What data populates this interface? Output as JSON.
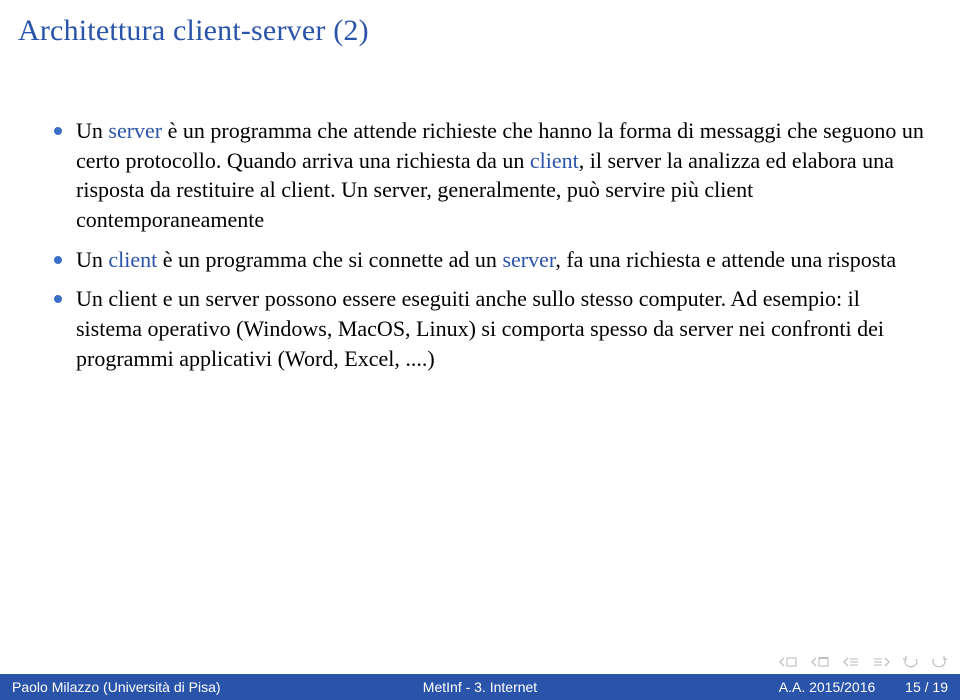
{
  "title": "Architettura client-server (2)",
  "bullets": {
    "b1a": "Un ",
    "b1k1": "server",
    "b1b": " è un programma che attende richieste che hanno la forma di messaggi che seguono un certo protocollo. Quando arriva una richiesta da un ",
    "b1k2": "client",
    "b1c": ", il server la analizza ed elabora una risposta da restituire al client. Un server, generalmente, può servire più client contemporaneamente",
    "b2a": "Un ",
    "b2k1": "client",
    "b2b": " è un programma che si connette ad un ",
    "b2k2": "server",
    "b2c": ", fa una richiesta e attende una risposta",
    "b3": "Un client e un server possono essere eseguiti anche sullo stesso computer. Ad esempio: il sistema operativo (Windows, MacOS, Linux) si comporta spesso da server nei confronti dei programmi applicativi (Word, Excel, ....)"
  },
  "footer": {
    "author": "Paolo Milazzo (Università di Pisa)",
    "course": "MetInf - 3. Internet",
    "year": "A.A. 2015/2016",
    "page": "15 / 19"
  }
}
